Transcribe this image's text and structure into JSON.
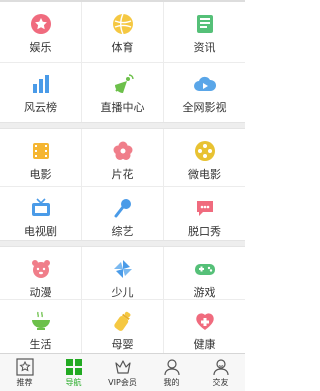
{
  "colors": {
    "active": "#22aa22",
    "text": "#333333"
  },
  "sections": [
    {
      "rows": [
        [
          {
            "label": "娱乐",
            "icon": "star-icon",
            "color": "#f06b7e"
          },
          {
            "label": "体育",
            "icon": "ball-icon",
            "color": "#f5c842"
          },
          {
            "label": "资讯",
            "icon": "news-icon",
            "color": "#55c078"
          }
        ],
        [
          {
            "label": "风云榜",
            "icon": "chart-bars-icon",
            "color": "#4a9be8"
          },
          {
            "label": "直播中心",
            "icon": "satellite-dish-icon",
            "color": "#6cc04a"
          },
          {
            "label": "全网影视",
            "icon": "cloud-icon",
            "color": "#5aa6e8"
          }
        ]
      ]
    },
    {
      "rows": [
        [
          {
            "label": "电影",
            "icon": "film-icon",
            "color": "#f5b632"
          },
          {
            "label": "片花",
            "icon": "flower-icon",
            "color": "#f07e8a"
          },
          {
            "label": "微电影",
            "icon": "film-reel-icon",
            "color": "#e8c232"
          }
        ],
        [
          {
            "label": "电视剧",
            "icon": "tv-icon",
            "color": "#4a9be8"
          },
          {
            "label": "综艺",
            "icon": "microphone-icon",
            "color": "#4a9be8"
          },
          {
            "label": "脱口秀",
            "icon": "speech-icon",
            "color": "#f06b7e"
          }
        ]
      ]
    },
    {
      "rows": [
        [
          {
            "label": "动漫",
            "icon": "bear-icon",
            "color": "#f07e8a"
          },
          {
            "label": "少儿",
            "icon": "pinwheel-icon",
            "color": "#4a9be8"
          },
          {
            "label": "游戏",
            "icon": "gamepad-icon",
            "color": "#55c078"
          }
        ],
        [
          {
            "label": "生活",
            "icon": "bowl-icon",
            "color": "#6cc04a"
          },
          {
            "label": "母婴",
            "icon": "bottle-icon",
            "color": "#f5c842"
          },
          {
            "label": "健康",
            "icon": "heart-icon",
            "color": "#f06b7e"
          }
        ]
      ]
    }
  ],
  "tabs": [
    {
      "label": "推荐",
      "icon": "recommend-star-icon",
      "active": false
    },
    {
      "label": "导航",
      "icon": "grid-icon",
      "active": true
    },
    {
      "label": "VIP会员",
      "icon": "crown-icon",
      "active": false
    },
    {
      "label": "我的",
      "icon": "person-icon",
      "active": false
    },
    {
      "label": "交友",
      "icon": "friends-icon",
      "active": false
    }
  ]
}
